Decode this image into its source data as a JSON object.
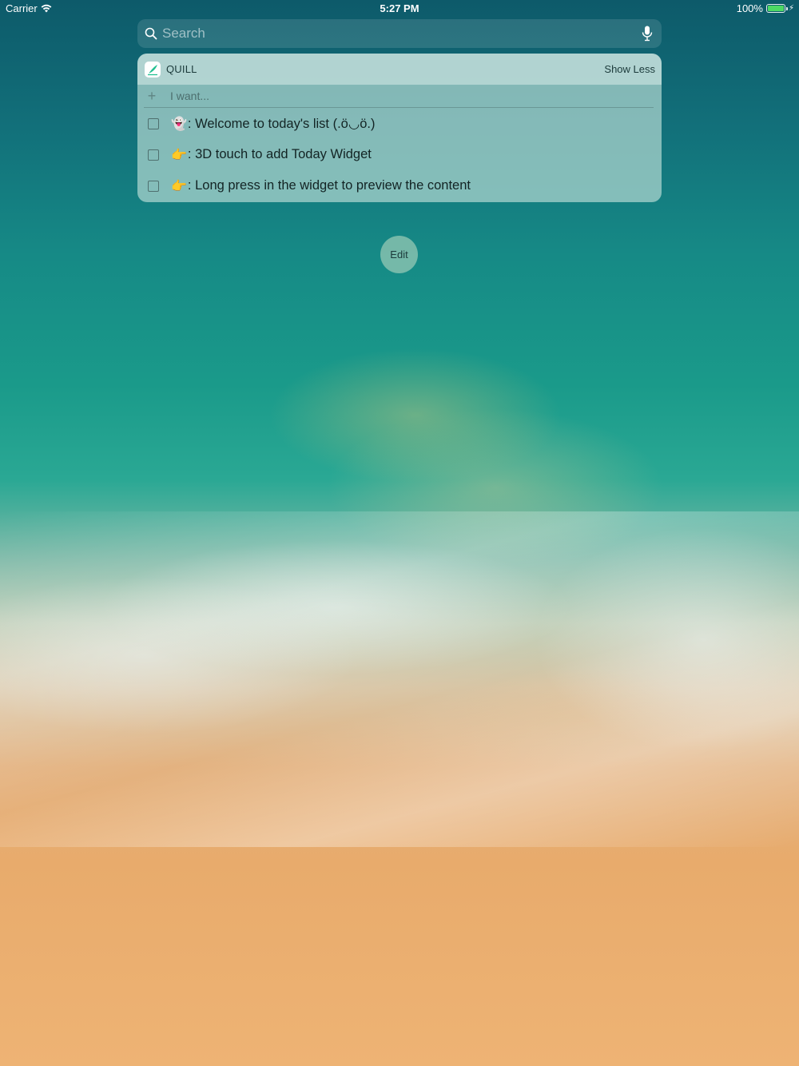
{
  "status_bar": {
    "carrier": "Carrier",
    "time": "5:27 PM",
    "battery": "100%"
  },
  "search": {
    "placeholder": "Search"
  },
  "widget": {
    "app_name": "QUILL",
    "toggle_label": "Show Less",
    "add_placeholder": "I want...",
    "items": [
      {
        "emoji": "👻",
        "text": ": Welcome to today's list (.ö◡ö.)",
        "checked": false
      },
      {
        "emoji": "👉",
        "text": ": 3D touch to add Today Widget",
        "checked": false
      },
      {
        "emoji": "👉",
        "text": ": Long press in the widget to preview the content",
        "checked": false
      }
    ]
  },
  "edit_button": {
    "label": "Edit"
  },
  "colors": {
    "battery": "#4cd964",
    "accent": "#1fbf8f"
  }
}
